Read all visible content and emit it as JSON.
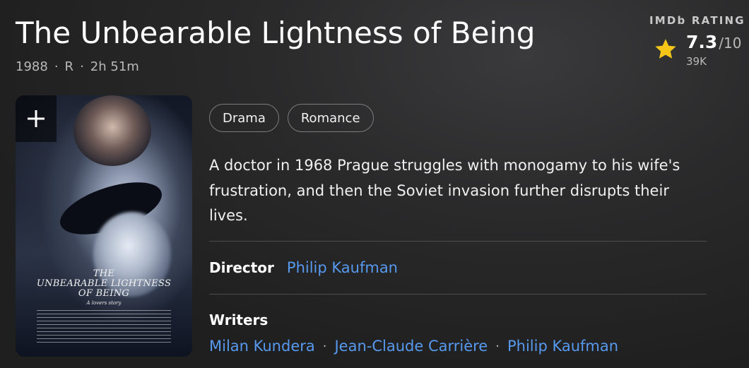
{
  "movie": {
    "title": "The Unbearable Lightness of Being",
    "year": "1988",
    "certificate": "R",
    "runtime": "2h 51m"
  },
  "rating": {
    "label": "IMDb RATING",
    "score": "7.3",
    "out_of": "/10",
    "count": "39K",
    "icon": "star-icon",
    "star_color": "#f5c518"
  },
  "poster": {
    "add_icon": "plus-icon",
    "title_line1": "THE",
    "title_line2": "UNBEARABLE LIGHTNESS",
    "title_line3": "OF BEING",
    "tagline": "A lovers story"
  },
  "genres": [
    "Drama",
    "Romance"
  ],
  "plot": "A doctor in 1968 Prague struggles with monogamy to his wife's frustration, and then the Soviet invasion further disrupts their lives.",
  "director": {
    "label": "Director",
    "name": "Philip Kaufman"
  },
  "writers": {
    "label": "Writers",
    "names": [
      "Milan Kundera",
      "Jean-Claude Carrière",
      "Philip Kaufman"
    ]
  },
  "colors": {
    "link": "#5799ef",
    "background": "#262627"
  }
}
